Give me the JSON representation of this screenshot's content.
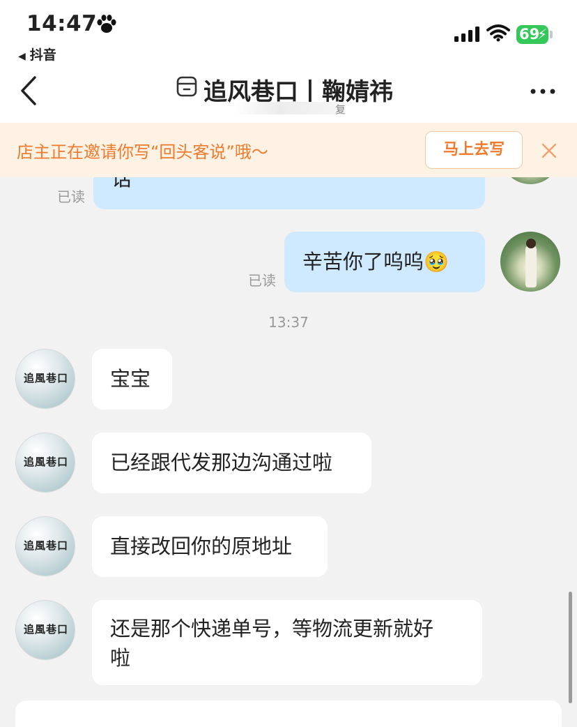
{
  "status_bar": {
    "time": "14:47",
    "back_app": "抖音",
    "battery": "69",
    "icons": [
      "paw-icon",
      "signal-icon",
      "wifi-icon",
      "battery-icon"
    ]
  },
  "nav": {
    "title": "追风巷口丨鞠婧祎",
    "subtitle": "复"
  },
  "banner": {
    "text": "店主正在邀请你写“回头客说”哦～",
    "button": "马上去写"
  },
  "messages": [
    {
      "from": "me",
      "text": "话",
      "read": "已读"
    },
    {
      "from": "me",
      "text": "辛苦你了呜呜🥹",
      "read": "已读"
    },
    {
      "timestamp": "13:37"
    },
    {
      "from": "shop",
      "text": "宝宝"
    },
    {
      "from": "shop",
      "text": "已经跟代发那边沟通过啦"
    },
    {
      "from": "shop",
      "text": "直接改回你的原地址"
    },
    {
      "from": "shop",
      "text": "还是那个快递单号，等物流更新就好",
      "text_line2": "啦"
    }
  ],
  "shop_avatar_text": "追風巷口",
  "colors": {
    "banner_accent": "#f07a2c",
    "my_bubble": "#cfe9ff",
    "battery_green": "#34c759"
  }
}
